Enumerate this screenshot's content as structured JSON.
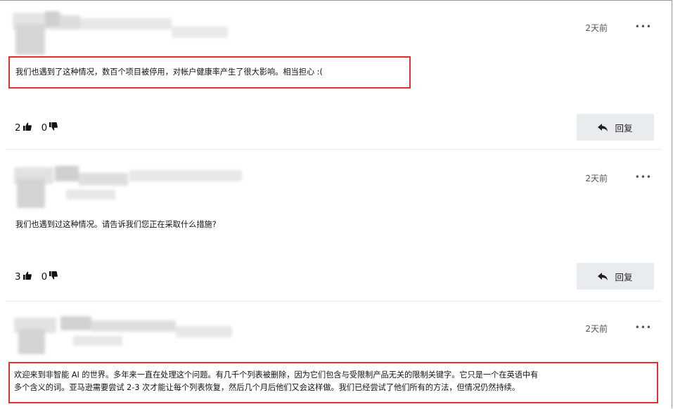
{
  "comments": [
    {
      "time": "2天前",
      "more": "•••",
      "text": "我们也遇到了这种情况，数百个项目被停用，对帐户健康率产生了很大影响。相当担心 :(",
      "likes": "2",
      "dislikes": "0",
      "reply_label": "回复"
    },
    {
      "time": "2天前",
      "more": "•••",
      "text": "我们也遇到过这种情况。请告诉我们您正在采取什么措施?",
      "likes": "3",
      "dislikes": "0",
      "reply_label": "回复"
    },
    {
      "time": "2天前",
      "more": "•••",
      "text_line1": "欢迎来到非智能 AI 的世界。多年来一直在处理这个问题。有几千个列表被删除，因为它们包含与受限制产品无关的限制关键字。它只是一个在英语中有",
      "text_line2": "多个含义的词。亚马逊需要尝试 2-3 次才能让每个列表恢复，然后几个月后他们又会这样做。我们已经尝试了他们所有的方法，但情况仍然持续。"
    }
  ],
  "icons": {
    "like": "thumbs-up-icon",
    "dislike": "thumbs-down-icon",
    "reply": "reply-arrow-icon"
  },
  "colors": {
    "highlight": "#e1312f",
    "reply_bg": "#e9ecef"
  }
}
